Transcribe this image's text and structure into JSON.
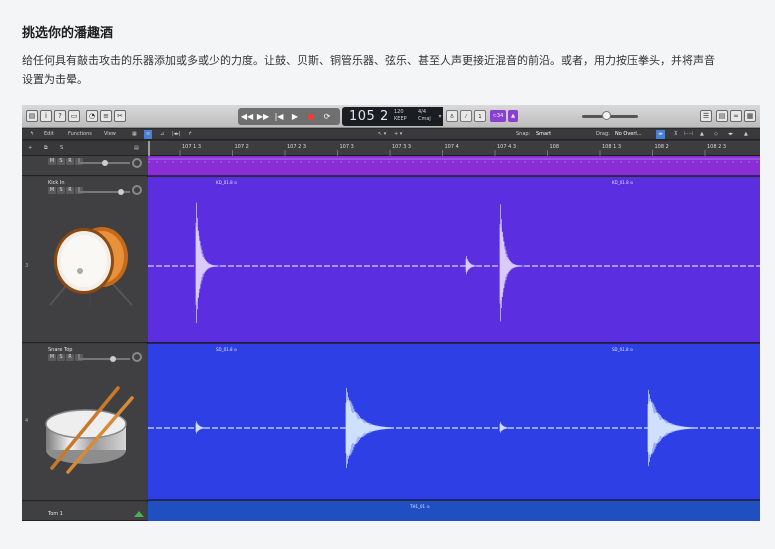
{
  "article": {
    "heading": "挑选你的潘趣酒",
    "description": "给任何具有敲击攻击的乐器添加或多或少的力度。让鼓、贝斯、铜管乐器、弦乐、甚至人声更接近混音的前沿。或者，用力按压拳头，并将声音设置为击晕。"
  },
  "daw": {
    "lcd": {
      "position": "105 2",
      "tempo": "120",
      "tempo_unit": "KEEP",
      "signature": "4/4",
      "key": "Cmaj"
    },
    "mode_label": "⊂34",
    "toolbar": {
      "edit": "Edit",
      "functions": "Functions",
      "view": "View",
      "snap_label": "Snap:",
      "snap_value": "Smart",
      "drag_label": "Drag:",
      "drag_value": "No Overl..."
    },
    "ruler_labels": [
      "107 1 3",
      "107 2",
      "107 2 3",
      "107 3",
      "107 3 3",
      "107 4",
      "107 4 3",
      "108",
      "108 1 3",
      "108 2",
      "108 2 3"
    ],
    "tracks": [
      {
        "number": "",
        "name": "",
        "color": "#8a2fd6"
      },
      {
        "number": "3",
        "name": "Kick In",
        "color": "#5b2fe0",
        "region_labels": [
          "KD_01.8 ⊙",
          "KD_01.8 ⊙"
        ]
      },
      {
        "number": "4",
        "name": "Snare Top",
        "color": "#2f3fe6",
        "region_labels": [
          "SD_01.8 ⊙",
          "SD_01.8 ⊙"
        ]
      },
      {
        "number": "",
        "name": "Tom 1",
        "color": "#1f4fc0",
        "region_labels": [
          "TH1_01 ⊙"
        ]
      }
    ],
    "msr_buttons": [
      "M",
      "S",
      "R",
      "I"
    ]
  }
}
